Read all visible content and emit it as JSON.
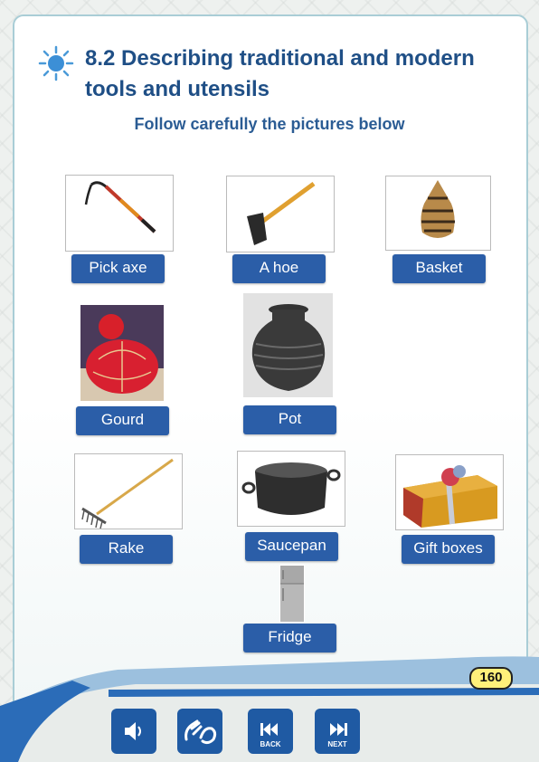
{
  "header": {
    "title": "8.2 Describing traditional and modern tools and utensils",
    "subtitle": "Follow carefully the pictures below"
  },
  "items": [
    {
      "label": "Pick axe"
    },
    {
      "label": "A hoe"
    },
    {
      "label": "Basket"
    },
    {
      "label": "Gourd"
    },
    {
      "label": "Pot"
    },
    {
      "label": "Rake"
    },
    {
      "label": "Saucepan"
    },
    {
      "label": "Gift boxes"
    },
    {
      "label": "Fridge"
    }
  ],
  "footer": {
    "page_number": "160",
    "buttons": {
      "audio": "speaker-icon",
      "sign": "sign-language-icon",
      "back_label": "BACK",
      "next_label": "NEXT"
    }
  },
  "colors": {
    "title": "#1f4f86",
    "label_bg": "#2b5ea8",
    "nav_bg": "#1f5aa3",
    "page_badge": "#fff07a"
  }
}
